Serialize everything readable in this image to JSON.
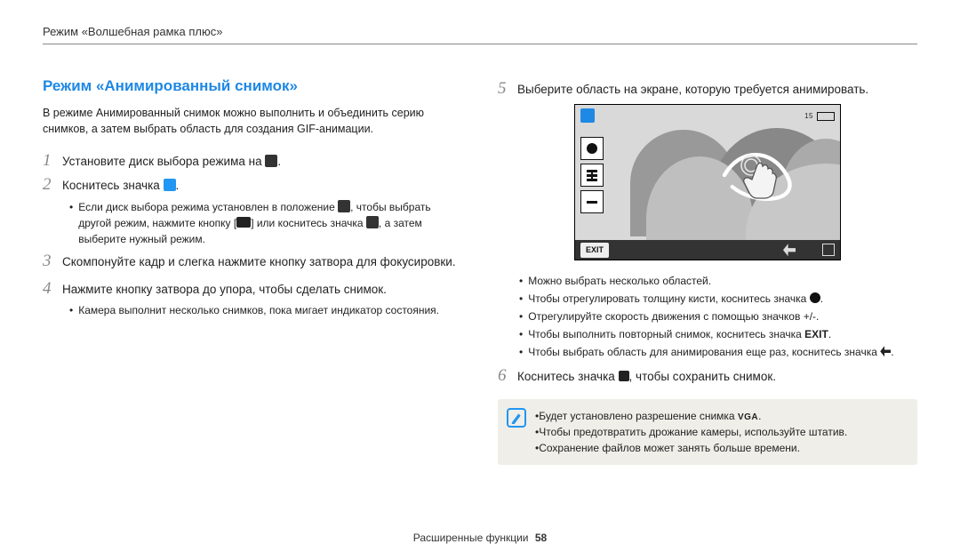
{
  "breadcrumb": "Режим «Волшебная рамка плюс»",
  "section_title": "Режим «Анимированный снимок»",
  "intro": "В режиме Анимированный снимок можно выполнить и объединить серию снимков, а затем выбрать область для создания GIF-анимации.",
  "steps": {
    "s1_pre": "Установите диск выбора режима на ",
    "s1_post": ".",
    "s2_pre": "Коснитесь значка ",
    "s2_post": ".",
    "s2_sub_a_pre": "Если диск выбора режима установлен в положение ",
    "s2_sub_a_mid1": ", чтобы выбрать другой режим, нажмите кнопку [",
    "s2_sub_a_mid2": "] или коснитесь значка ",
    "s2_sub_a_post": ", а затем выберите нужный режим.",
    "s3": "Скомпонуйте кадр и слегка нажмите кнопку затвора для фокусировки.",
    "s4": "Нажмите кнопку затвора до упора, чтобы сделать снимок.",
    "s4_sub": "Камера выполнит несколько снимков, пока мигает индикатор состояния.",
    "s5": "Выберите область на экране, которую требуется анимировать.",
    "s5_bullets": {
      "b1": "Можно выбрать несколько областей.",
      "b2_pre": "Чтобы отрегулировать толщину кисти, коснитесь значка ",
      "b2_post": ".",
      "b3": "Отрегулируйте скорость движения с помощью значков +/-.",
      "b4_pre": "Чтобы выполнить повторный снимок, коснитесь значка ",
      "b4_exit": "EXIT",
      "b4_post": ".",
      "b5_pre": "Чтобы выбрать область для анимирования еще раз, коснитесь значка ",
      "b5_post": "."
    },
    "s6_pre": "Коснитесь значка ",
    "s6_post": ", чтобы сохранить снимок."
  },
  "tips": {
    "t1_pre": "Будет установлено разрешение снимка ",
    "t1_vga": "VGA",
    "t1_post": ".",
    "t2": "Чтобы предотвратить дрожание камеры, используйте штатив.",
    "t3": "Сохранение файлов может занять больше времени."
  },
  "screenshot": {
    "topbar_right": "15",
    "exit_label": "EXIT"
  },
  "footer": {
    "label": "Расширенные функции",
    "page": "58"
  }
}
